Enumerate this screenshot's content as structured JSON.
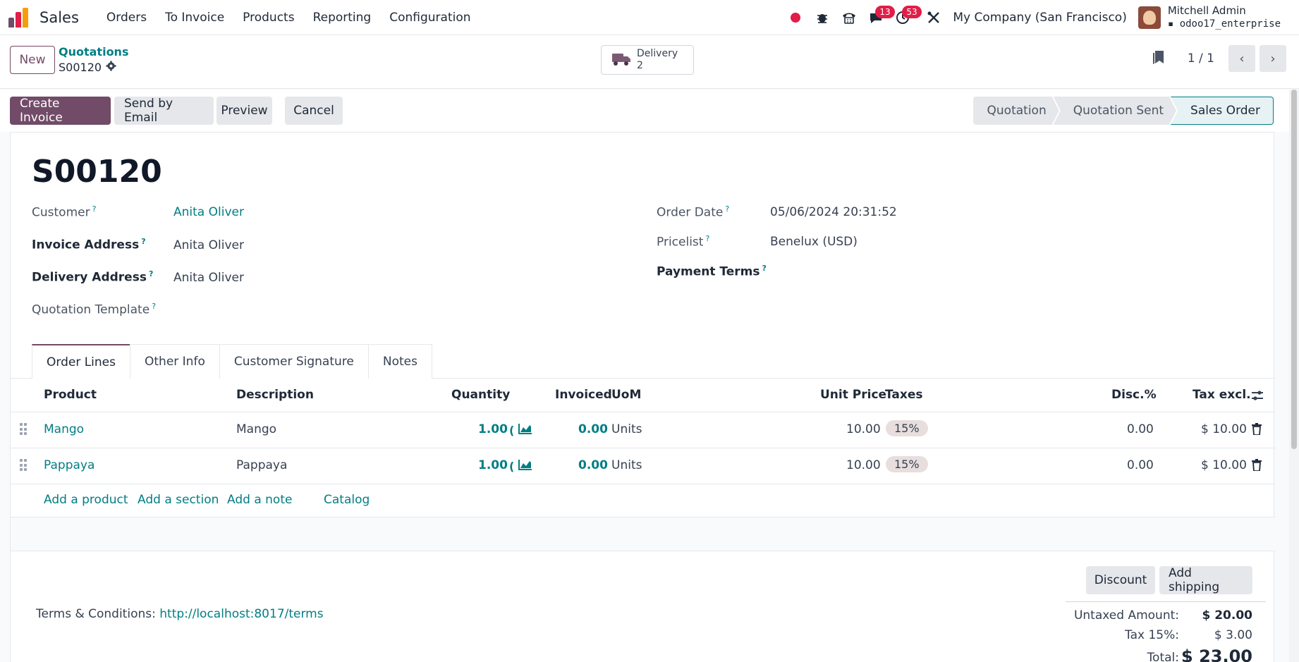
{
  "navbar": {
    "app_name": "Sales",
    "menu": [
      "Orders",
      "To Invoice",
      "Products",
      "Reporting",
      "Configuration"
    ],
    "messages_count": "13",
    "activities_count": "53",
    "company": "My Company (San Francisco)",
    "user_name": "Mitchell Admin",
    "db_name": "odoo17_enterprise",
    "colors": {
      "brand": "#714b67",
      "link": "#017e84",
      "badge": "#e11d48"
    }
  },
  "control": {
    "new_label": "New",
    "breadcrumb_parent": "Quotations",
    "breadcrumb_current": "S00120",
    "smart_button": {
      "label": "Delivery",
      "count": "2"
    },
    "pager_value": "1 / 1"
  },
  "actions": {
    "create_invoice": "Create Invoice",
    "send_email": "Send by Email",
    "preview": "Preview",
    "cancel": "Cancel"
  },
  "statusbar": {
    "stages": [
      "Quotation",
      "Quotation Sent",
      "Sales Order"
    ],
    "active": "Sales Order"
  },
  "form": {
    "title": "S00120",
    "customer_label": "Customer",
    "customer": "Anita Oliver",
    "invoice_address_label": "Invoice Address",
    "invoice_address": "Anita Oliver",
    "delivery_address_label": "Delivery Address",
    "delivery_address": "Anita Oliver",
    "quotation_template_label": "Quotation Template",
    "order_date_label": "Order Date",
    "order_date": "05/06/2024 20:31:52",
    "pricelist_label": "Pricelist",
    "pricelist": "Benelux (USD)",
    "payment_terms_label": "Payment Terms",
    "help_mark": "?"
  },
  "tabs": [
    "Order Lines",
    "Other Info",
    "Customer Signature",
    "Notes"
  ],
  "table": {
    "columns": {
      "product": "Product",
      "description": "Description",
      "quantity": "Quantity",
      "invoiced": "Invoiced",
      "uom": "UoM",
      "unit_price": "Unit Price",
      "taxes": "Taxes",
      "discount": "Disc.%",
      "tax_excl": "Tax excl."
    },
    "rows": [
      {
        "product": "Mango",
        "description": "Mango",
        "quantity": "1.00",
        "invoiced": "0.00",
        "uom": "Units",
        "unit_price": "10.00",
        "tax": "15%",
        "discount": "0.00",
        "tax_excl": "$ 10.00"
      },
      {
        "product": "Pappaya",
        "description": "Pappaya",
        "quantity": "1.00",
        "invoiced": "0.00",
        "uom": "Units",
        "unit_price": "10.00",
        "tax": "15%",
        "discount": "0.00",
        "tax_excl": "$ 10.00"
      }
    ],
    "add_product": "Add a product",
    "add_section": "Add a section",
    "add_note": "Add a note",
    "catalog": "Catalog"
  },
  "footer": {
    "discount_btn": "Discount",
    "shipping_btn": "Add shipping",
    "terms_label": "Terms & Conditions:",
    "terms_link": "http://localhost:8017/terms",
    "untaxed_label": "Untaxed Amount:",
    "untaxed_value": "$ 20.00",
    "tax_label": "Tax 15%:",
    "tax_value": "$ 3.00",
    "total_label": "Total:",
    "total_value": "$ 23.00"
  }
}
